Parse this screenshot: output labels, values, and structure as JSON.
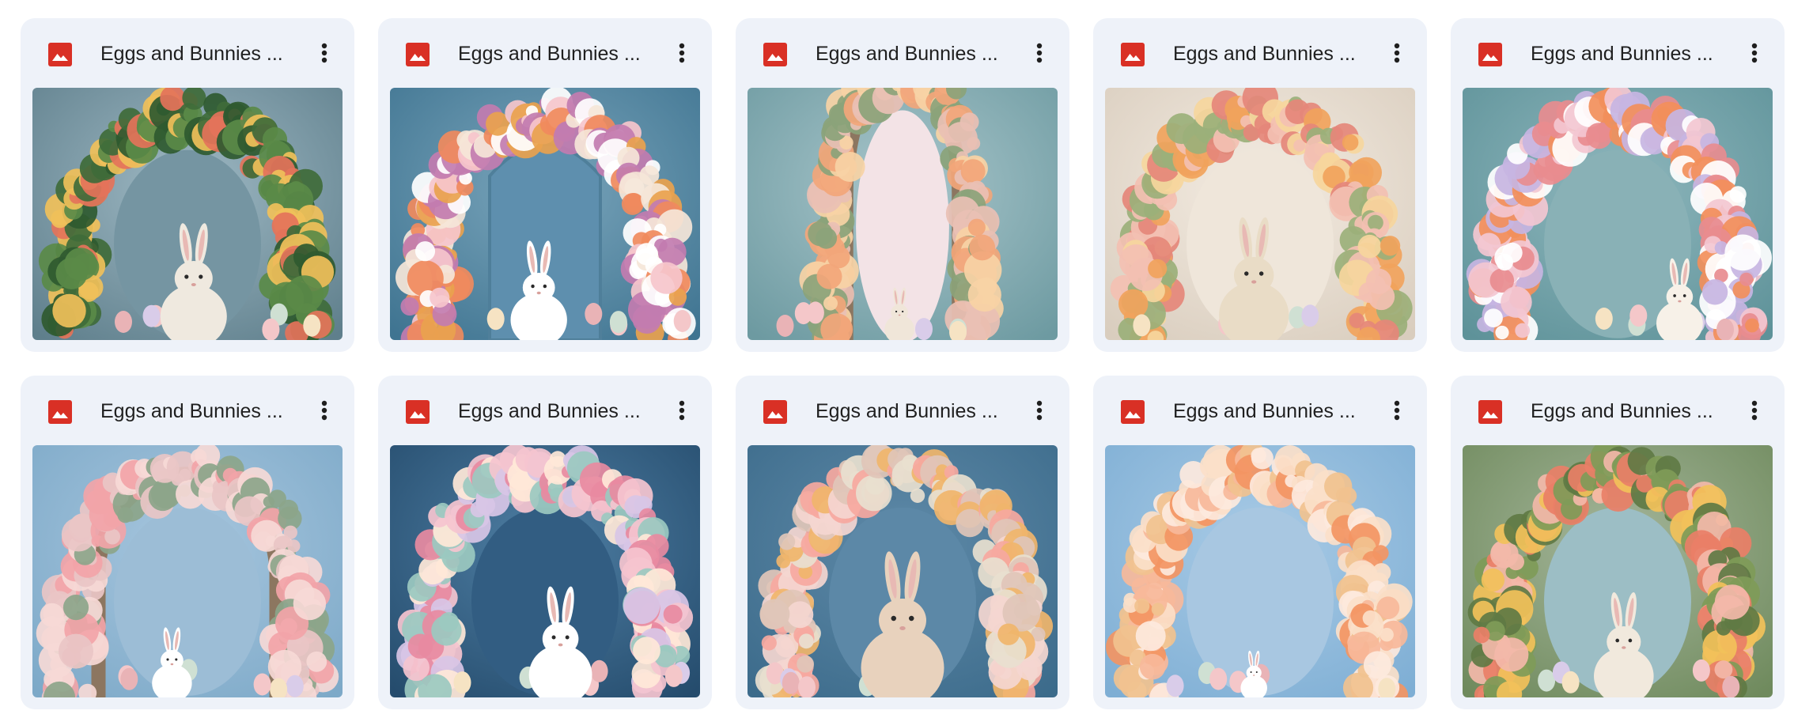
{
  "files": [
    {
      "title": "Eggs and Bunnies ...",
      "file_type_icon": "image-file-icon",
      "menu_icon": "more-vert-icon",
      "thumbnail": "Easter greenery arch with white bunny on blue-teal backdrop"
    },
    {
      "title": "Eggs and Bunnies ...",
      "file_type_icon": "image-file-icon",
      "menu_icon": "more-vert-icon",
      "thumbnail": "Flower and egg arch around blue door with white bunny"
    },
    {
      "title": "Eggs and Bunnies ...",
      "file_type_icon": "image-file-icon",
      "menu_icon": "more-vert-icon",
      "thumbnail": "Stone arch with flowers and pink cloud sky, small bunny"
    },
    {
      "title": "Eggs and Bunnies ...",
      "file_type_icon": "image-file-icon",
      "menu_icon": "more-vert-icon",
      "thumbnail": "Wildflower arch with tan bunny on cream backdrop"
    },
    {
      "title": "Eggs and Bunnies ...",
      "file_type_icon": "image-file-icon",
      "menu_icon": "more-vert-icon",
      "thumbnail": "Round flower and egg wreath with bunny on teal"
    },
    {
      "title": "Eggs and Bunnies ...",
      "file_type_icon": "image-file-icon",
      "menu_icon": "more-vert-icon",
      "thumbnail": "Pink floral arch with small white bunny on blue sky"
    },
    {
      "title": "Eggs and Bunnies ...",
      "file_type_icon": "image-file-icon",
      "menu_icon": "more-vert-icon",
      "thumbnail": "Pastel egg and flower arch with white bunny on dark blue"
    },
    {
      "title": "Eggs and Bunnies ...",
      "file_type_icon": "image-file-icon",
      "menu_icon": "more-vert-icon",
      "thumbnail": "Large pastel eggs arch framing brown bunny close-up"
    },
    {
      "title": "Eggs and Bunnies ...",
      "file_type_icon": "image-file-icon",
      "menu_icon": "more-vert-icon",
      "thumbnail": "Peach and orange floral arch on blue cloud sky"
    },
    {
      "title": "Eggs and Bunnies ...",
      "file_type_icon": "image-file-icon",
      "menu_icon": "more-vert-icon",
      "thumbnail": "Mossy flower arch with pink egg and white bunny"
    }
  ],
  "colors": {
    "card_background": "#eef2f9",
    "title_text": "#1f1f1f",
    "image_icon_red": "#d93025",
    "menu_dots": "#1f1f1f"
  }
}
